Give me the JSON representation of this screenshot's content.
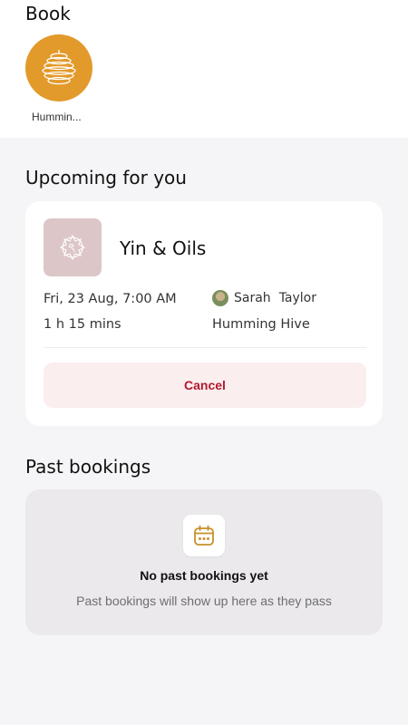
{
  "book": {
    "title": "Book",
    "studio": {
      "name": "Hummin...",
      "logo_color": "#e29a2a"
    }
  },
  "upcoming": {
    "heading": "Upcoming for you",
    "class": {
      "name": "Yin & Oils",
      "thumb_color": "#dcc6c7",
      "date": "Fri, 23 Aug, 7:00 AM",
      "duration": "1 h 15 mins",
      "instructor_first": "Sarah",
      "instructor_last": "Taylor",
      "location": "Humming Hive"
    },
    "cancel_label": "Cancel",
    "cancel_color": "#b3192e"
  },
  "past": {
    "heading": "Past bookings",
    "empty_title": "No past bookings yet",
    "empty_subtitle": "Past bookings will show up here as they pass",
    "icon": "calendar-icon",
    "icon_color": "#c8902a"
  }
}
